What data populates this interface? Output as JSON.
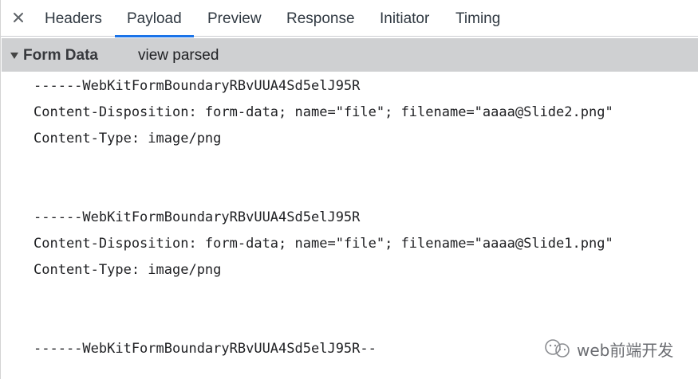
{
  "tabs": {
    "close_label": "×",
    "items": [
      {
        "label": "Headers"
      },
      {
        "label": "Payload",
        "active": true
      },
      {
        "label": "Preview"
      },
      {
        "label": "Response"
      },
      {
        "label": "Initiator"
      },
      {
        "label": "Timing"
      }
    ]
  },
  "section": {
    "title": "Form Data",
    "toggle_icon": "triangle-down-icon",
    "action_label": "view parsed"
  },
  "payload": {
    "lines": [
      "------WebKitFormBoundaryRBvUUA4Sd5elJ95R",
      "Content-Disposition: form-data; name=\"file\"; filename=\"aaaa@Slide2.png\"",
      "Content-Type: image/png",
      "------WebKitFormBoundaryRBvUUA4Sd5elJ95R",
      "Content-Disposition: form-data; name=\"file\"; filename=\"aaaa@Slide1.png\"",
      "Content-Type: image/png",
      "------WebKitFormBoundaryRBvUUA4Sd5elJ95R--"
    ]
  },
  "watermark": {
    "text": "web前端开发",
    "icon": "wechat-logo-icon"
  },
  "colors": {
    "active_tab_underline": "#1a73e8",
    "section_header_bg": "#cfd0d2",
    "text": "#202124"
  }
}
